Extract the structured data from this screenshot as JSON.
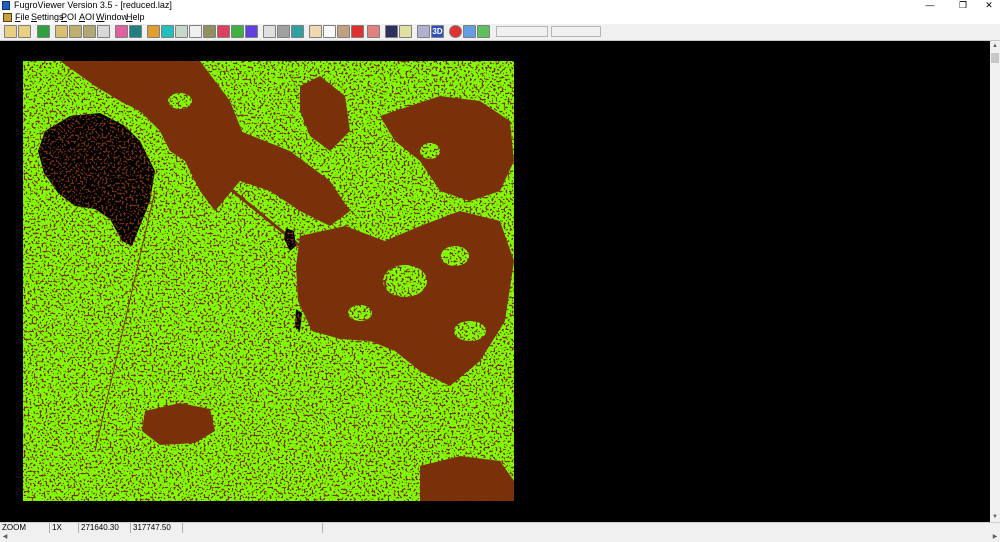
{
  "window": {
    "title": "FugroViewer Version 3.5 - [reduced.laz]",
    "controls": {
      "minimize": "—",
      "restore": "❐",
      "close": "✕"
    }
  },
  "menu": {
    "items": [
      {
        "key": "F",
        "rest": "ile"
      },
      {
        "key": "S",
        "rest": "ettings"
      },
      {
        "key": "P",
        "rest": "OI"
      },
      {
        "key": "A",
        "rest": "OI"
      },
      {
        "key": "W",
        "rest": "indow"
      },
      {
        "key": "H",
        "rest": "elp"
      }
    ]
  },
  "toolbar": {
    "label_3d": "3D",
    "icons": [
      "open-file-icon",
      "open-folder-icon",
      "refresh-icon",
      "layers-icon",
      "layers-alt-icon",
      "layers-stack-icon",
      "grid-icon",
      "target-icon",
      "profile-icon",
      "color-ramp-icon",
      "cyan-square-icon",
      "select-points-icon",
      "line-tool-icon",
      "mountain-icon",
      "palette-icon",
      "rainbow-icon",
      "spectrum-icon",
      "points-icon",
      "grid-points-icon",
      "tin-icon",
      "hand-pan-icon",
      "zoom-icon",
      "measure-icon",
      "pin-icon",
      "compass-icon",
      "help-query-icon",
      "ruler-icon",
      "pencil-icon",
      "3d-view-icon",
      "stop-icon",
      "palette-alt-icon",
      "export-icon"
    ]
  },
  "colors": {
    "ground": "#7fff00",
    "vegetation": "#7a3008",
    "background": "#000000"
  },
  "status": {
    "mode": "ZOOM",
    "zoom": "1X",
    "x": "271640.30",
    "y": "317747.50"
  }
}
